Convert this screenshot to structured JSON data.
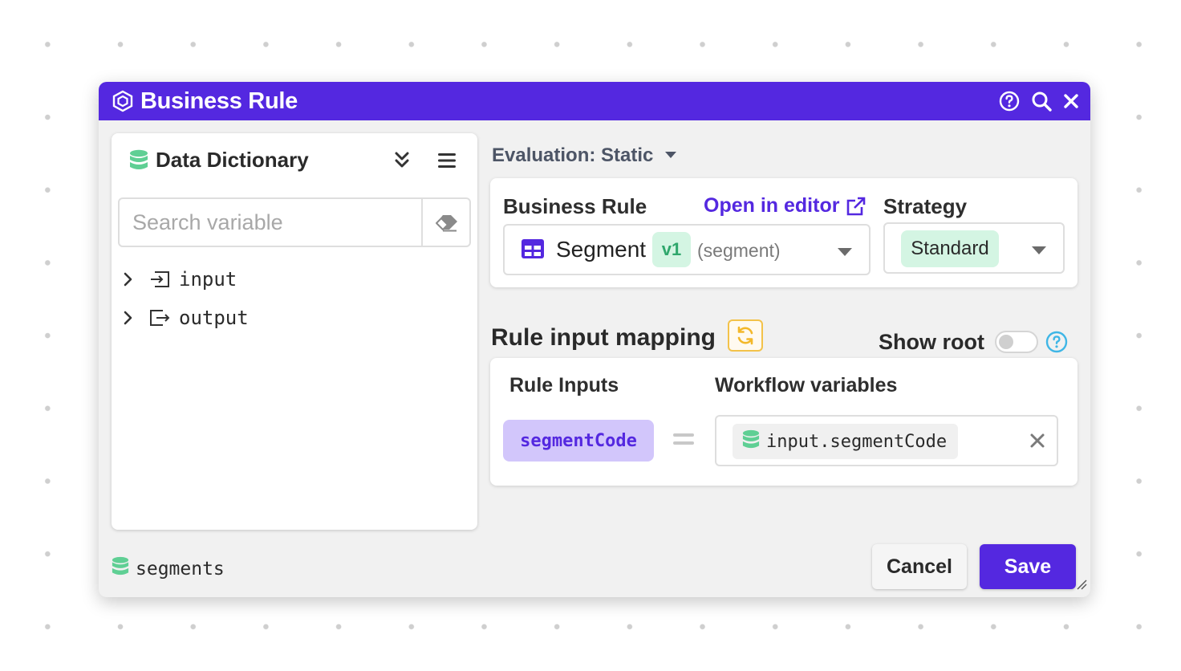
{
  "window": {
    "title": "Business Rule",
    "accent_color": "#5428e0",
    "controls": [
      "help-icon",
      "search-icon",
      "close-icon"
    ]
  },
  "data_dictionary": {
    "title": "Data Dictionary",
    "search_placeholder": "Search variable",
    "tree": [
      {
        "label": "input",
        "icon": "input-icon"
      },
      {
        "label": "output",
        "icon": "output-icon"
      }
    ],
    "footer_label": "segments"
  },
  "evaluation": {
    "label": "Evaluation: Static"
  },
  "business_rule": {
    "label": "Business Rule",
    "open_in_editor": "Open in editor",
    "selected": {
      "name": "Segment",
      "version": "v1",
      "key": "(segment)"
    },
    "strategy_label": "Strategy",
    "strategy_value": "Standard"
  },
  "mapping": {
    "title": "Rule input mapping",
    "show_root_label": "Show root",
    "show_root_on": false,
    "col_rule_inputs": "Rule Inputs",
    "col_workflow_variables": "Workflow variables",
    "rows": [
      {
        "rule_input": "segmentCode",
        "workflow_variable": "input.segmentCode"
      }
    ]
  },
  "footer": {
    "cancel_label": "Cancel",
    "save_label": "Save"
  }
}
